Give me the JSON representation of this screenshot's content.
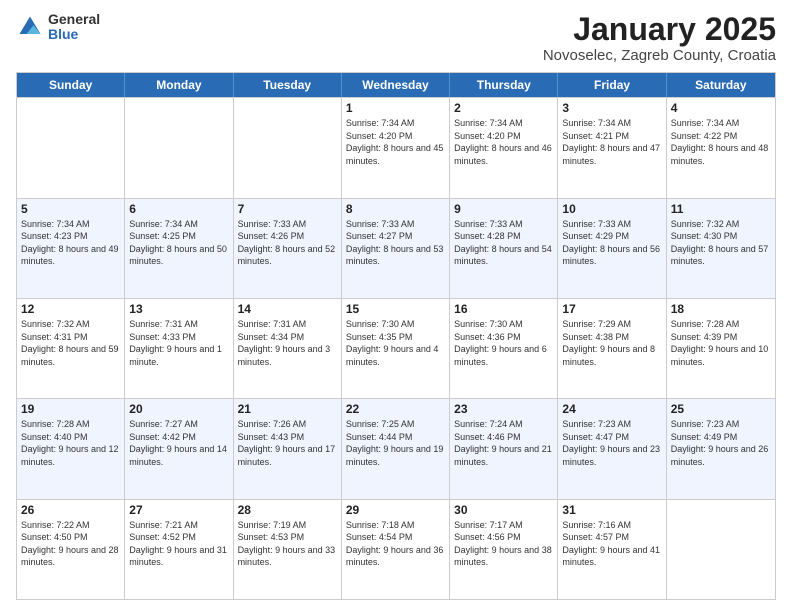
{
  "logo": {
    "general": "General",
    "blue": "Blue"
  },
  "title": "January 2025",
  "subtitle": "Novoselec, Zagreb County, Croatia",
  "days": [
    "Sunday",
    "Monday",
    "Tuesday",
    "Wednesday",
    "Thursday",
    "Friday",
    "Saturday"
  ],
  "weeks": [
    [
      {
        "num": "",
        "sunrise": "",
        "sunset": "",
        "daylight": ""
      },
      {
        "num": "",
        "sunrise": "",
        "sunset": "",
        "daylight": ""
      },
      {
        "num": "",
        "sunrise": "",
        "sunset": "",
        "daylight": ""
      },
      {
        "num": "1",
        "sunrise": "Sunrise: 7:34 AM",
        "sunset": "Sunset: 4:20 PM",
        "daylight": "Daylight: 8 hours and 45 minutes."
      },
      {
        "num": "2",
        "sunrise": "Sunrise: 7:34 AM",
        "sunset": "Sunset: 4:20 PM",
        "daylight": "Daylight: 8 hours and 46 minutes."
      },
      {
        "num": "3",
        "sunrise": "Sunrise: 7:34 AM",
        "sunset": "Sunset: 4:21 PM",
        "daylight": "Daylight: 8 hours and 47 minutes."
      },
      {
        "num": "4",
        "sunrise": "Sunrise: 7:34 AM",
        "sunset": "Sunset: 4:22 PM",
        "daylight": "Daylight: 8 hours and 48 minutes."
      }
    ],
    [
      {
        "num": "5",
        "sunrise": "Sunrise: 7:34 AM",
        "sunset": "Sunset: 4:23 PM",
        "daylight": "Daylight: 8 hours and 49 minutes."
      },
      {
        "num": "6",
        "sunrise": "Sunrise: 7:34 AM",
        "sunset": "Sunset: 4:25 PM",
        "daylight": "Daylight: 8 hours and 50 minutes."
      },
      {
        "num": "7",
        "sunrise": "Sunrise: 7:33 AM",
        "sunset": "Sunset: 4:26 PM",
        "daylight": "Daylight: 8 hours and 52 minutes."
      },
      {
        "num": "8",
        "sunrise": "Sunrise: 7:33 AM",
        "sunset": "Sunset: 4:27 PM",
        "daylight": "Daylight: 8 hours and 53 minutes."
      },
      {
        "num": "9",
        "sunrise": "Sunrise: 7:33 AM",
        "sunset": "Sunset: 4:28 PM",
        "daylight": "Daylight: 8 hours and 54 minutes."
      },
      {
        "num": "10",
        "sunrise": "Sunrise: 7:33 AM",
        "sunset": "Sunset: 4:29 PM",
        "daylight": "Daylight: 8 hours and 56 minutes."
      },
      {
        "num": "11",
        "sunrise": "Sunrise: 7:32 AM",
        "sunset": "Sunset: 4:30 PM",
        "daylight": "Daylight: 8 hours and 57 minutes."
      }
    ],
    [
      {
        "num": "12",
        "sunrise": "Sunrise: 7:32 AM",
        "sunset": "Sunset: 4:31 PM",
        "daylight": "Daylight: 8 hours and 59 minutes."
      },
      {
        "num": "13",
        "sunrise": "Sunrise: 7:31 AM",
        "sunset": "Sunset: 4:33 PM",
        "daylight": "Daylight: 9 hours and 1 minute."
      },
      {
        "num": "14",
        "sunrise": "Sunrise: 7:31 AM",
        "sunset": "Sunset: 4:34 PM",
        "daylight": "Daylight: 9 hours and 3 minutes."
      },
      {
        "num": "15",
        "sunrise": "Sunrise: 7:30 AM",
        "sunset": "Sunset: 4:35 PM",
        "daylight": "Daylight: 9 hours and 4 minutes."
      },
      {
        "num": "16",
        "sunrise": "Sunrise: 7:30 AM",
        "sunset": "Sunset: 4:36 PM",
        "daylight": "Daylight: 9 hours and 6 minutes."
      },
      {
        "num": "17",
        "sunrise": "Sunrise: 7:29 AM",
        "sunset": "Sunset: 4:38 PM",
        "daylight": "Daylight: 9 hours and 8 minutes."
      },
      {
        "num": "18",
        "sunrise": "Sunrise: 7:28 AM",
        "sunset": "Sunset: 4:39 PM",
        "daylight": "Daylight: 9 hours and 10 minutes."
      }
    ],
    [
      {
        "num": "19",
        "sunrise": "Sunrise: 7:28 AM",
        "sunset": "Sunset: 4:40 PM",
        "daylight": "Daylight: 9 hours and 12 minutes."
      },
      {
        "num": "20",
        "sunrise": "Sunrise: 7:27 AM",
        "sunset": "Sunset: 4:42 PM",
        "daylight": "Daylight: 9 hours and 14 minutes."
      },
      {
        "num": "21",
        "sunrise": "Sunrise: 7:26 AM",
        "sunset": "Sunset: 4:43 PM",
        "daylight": "Daylight: 9 hours and 17 minutes."
      },
      {
        "num": "22",
        "sunrise": "Sunrise: 7:25 AM",
        "sunset": "Sunset: 4:44 PM",
        "daylight": "Daylight: 9 hours and 19 minutes."
      },
      {
        "num": "23",
        "sunrise": "Sunrise: 7:24 AM",
        "sunset": "Sunset: 4:46 PM",
        "daylight": "Daylight: 9 hours and 21 minutes."
      },
      {
        "num": "24",
        "sunrise": "Sunrise: 7:23 AM",
        "sunset": "Sunset: 4:47 PM",
        "daylight": "Daylight: 9 hours and 23 minutes."
      },
      {
        "num": "25",
        "sunrise": "Sunrise: 7:23 AM",
        "sunset": "Sunset: 4:49 PM",
        "daylight": "Daylight: 9 hours and 26 minutes."
      }
    ],
    [
      {
        "num": "26",
        "sunrise": "Sunrise: 7:22 AM",
        "sunset": "Sunset: 4:50 PM",
        "daylight": "Daylight: 9 hours and 28 minutes."
      },
      {
        "num": "27",
        "sunrise": "Sunrise: 7:21 AM",
        "sunset": "Sunset: 4:52 PM",
        "daylight": "Daylight: 9 hours and 31 minutes."
      },
      {
        "num": "28",
        "sunrise": "Sunrise: 7:19 AM",
        "sunset": "Sunset: 4:53 PM",
        "daylight": "Daylight: 9 hours and 33 minutes."
      },
      {
        "num": "29",
        "sunrise": "Sunrise: 7:18 AM",
        "sunset": "Sunset: 4:54 PM",
        "daylight": "Daylight: 9 hours and 36 minutes."
      },
      {
        "num": "30",
        "sunrise": "Sunrise: 7:17 AM",
        "sunset": "Sunset: 4:56 PM",
        "daylight": "Daylight: 9 hours and 38 minutes."
      },
      {
        "num": "31",
        "sunrise": "Sunrise: 7:16 AM",
        "sunset": "Sunset: 4:57 PM",
        "daylight": "Daylight: 9 hours and 41 minutes."
      },
      {
        "num": "",
        "sunrise": "",
        "sunset": "",
        "daylight": ""
      }
    ]
  ]
}
